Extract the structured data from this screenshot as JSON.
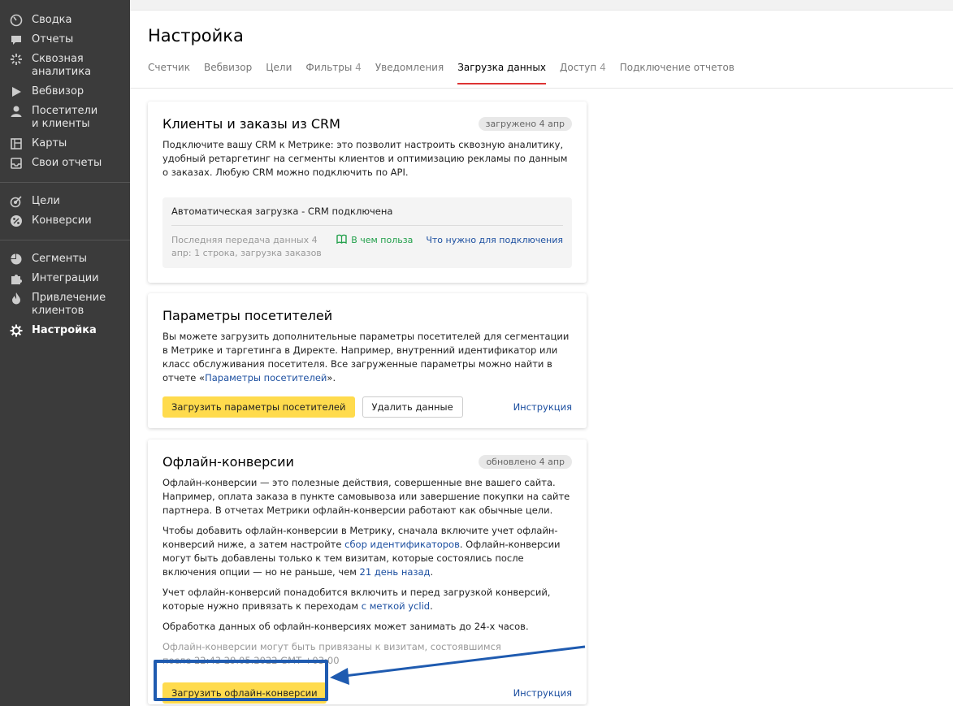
{
  "sidebar": {
    "items": [
      {
        "label": "Сводка",
        "icon": "gauge-icon"
      },
      {
        "label": "Отчеты",
        "icon": "chat-icon"
      },
      {
        "label": "Сквозная аналитика",
        "icon": "burst-icon"
      },
      {
        "label": "Вебвизор",
        "icon": "play-icon"
      },
      {
        "label": "Посетители и клиенты",
        "icon": "user-icon"
      },
      {
        "label": "Карты",
        "icon": "map-icon"
      },
      {
        "label": "Свои отчеты",
        "icon": "inbox-icon"
      },
      {
        "label": "Цели",
        "icon": "target-icon"
      },
      {
        "label": "Конверсии",
        "icon": "percent-icon"
      },
      {
        "label": "Сегменты",
        "icon": "pie-icon"
      },
      {
        "label": "Интеграции",
        "icon": "puzzle-icon"
      },
      {
        "label": "Привлечение клиентов",
        "icon": "flame-icon"
      },
      {
        "label": "Настройка",
        "icon": "gear-icon"
      }
    ]
  },
  "page": {
    "title": "Настройка"
  },
  "tabs": [
    {
      "label": "Счетчик",
      "count": ""
    },
    {
      "label": "Вебвизор",
      "count": ""
    },
    {
      "label": "Цели",
      "count": ""
    },
    {
      "label": "Фильтры",
      "count": "4"
    },
    {
      "label": "Уведомления",
      "count": ""
    },
    {
      "label": "Загрузка данных",
      "count": "",
      "active": true
    },
    {
      "label": "Доступ",
      "count": "4"
    },
    {
      "label": "Подключение отчетов",
      "count": ""
    }
  ],
  "crm": {
    "title": "Клиенты и заказы из CRM",
    "badge": "загружено 4 апр",
    "description": "Подключите вашу CRM к Метрике: это позволит настроить сквозную аналитику, удобный ретаргетинг на сегменты клиентов и оптимизацию рекламы по данным о заказах. Любую CRM можно подключить по API.",
    "status_title": "Автоматическая загрузка - CRM подключена",
    "status_text": "Последняя передача данных 4 апр: 1 строка, загрузка заказов",
    "benefit_link": "В чем польза",
    "requirements_link": "Что нужно для подключения"
  },
  "params": {
    "title": "Параметры посетителей",
    "description": "Вы можете загрузить дополнительные параметры посетителей для сегментации в Метрике и таргетинга в Директе. Например, внутренний идентификатор или класс обслуживания посетителя. Все загруженные параметры можно найти в отчете «",
    "report_link": "Параметры посетителей",
    "description_end": "».",
    "upload_button": "Загрузить параметры посетителей",
    "delete_button": "Удалить данные",
    "instruction_link": "Инструкция"
  },
  "offline": {
    "title": "Офлайн-конверсии",
    "badge": "обновлено 4 апр",
    "p1": "Офлайн-конверсии — это полезные действия, совершенные вне вашего сайта. Например, оплата заказа в пункте самовывоза или завершение покупки на сайте партнера. В отчетах Метрики офлайн-конверсии работают как обычные цели.",
    "p2_a": "Чтобы добавить офлайн-конверсии в Метрику, сначала включите учет офлайн-конверсий ниже, а затем настройте ",
    "p2_link1": "сбор идентификаторов",
    "p2_b": ". Офлайн-конверсии могут быть добавлены только к тем визитам, которые состоялись после включения опции — но не раньше, чем ",
    "p2_link2": "21 день назад",
    "p2_c": ".",
    "p3_a": "Учет офлайн-конверсий понадобится включить и перед загрузкой конверсий, которые нужно привязать к переходам ",
    "p3_link": "с меткой yclid",
    "p3_b": ".",
    "p4": "Обработка данных об офлайн-конверсиях может занимать до 24-х часов.",
    "p5": "Офлайн-конверсии могут быть привязаны к визитам, состоявшимся после 22:43 29.05.2022 GMT +03:00",
    "upload_button": "Загрузить офлайн-конверсии",
    "instruction_link": "Инструкция"
  },
  "colors": {
    "accent_yellow": "#ffdb4d",
    "highlight_blue": "#1f5bb0",
    "link_blue": "#1c4fa0",
    "green": "#22a04b",
    "tab_active": "#dd3333"
  }
}
